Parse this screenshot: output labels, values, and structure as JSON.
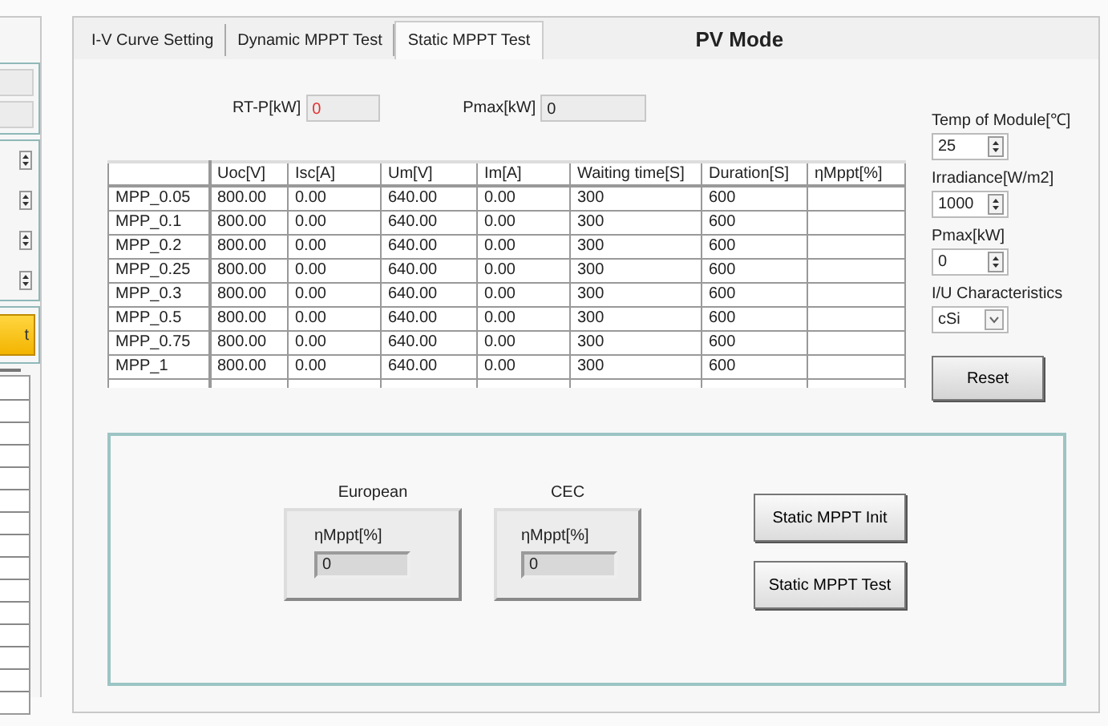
{
  "left_panel": {
    "button": "t"
  },
  "tabs": [
    {
      "label": "I-V Curve Setting",
      "selected": false
    },
    {
      "label": "Dynamic MPPT Test",
      "selected": false
    },
    {
      "label": "Static MPPT Test",
      "selected": true
    }
  ],
  "mode_title": "PV Mode",
  "readouts": [
    {
      "label": "RT-P[kW]",
      "value": "0",
      "color": "#e03030"
    },
    {
      "label": "Pmax[kW]",
      "value": "0",
      "color": "#222222"
    }
  ],
  "table": {
    "columns": [
      "Uoc[V]",
      "Isc[A]",
      "Um[V]",
      "Im[A]",
      "Waiting time[S]",
      "Duration[S]",
      "ηMppt[%]"
    ],
    "rows": [
      {
        "name": "MPP_0.05",
        "cells": [
          "800.00",
          "0.00",
          "640.00",
          "0.00",
          "300",
          "600"
        ]
      },
      {
        "name": "MPP_0.1",
        "cells": [
          "800.00",
          "0.00",
          "640.00",
          "0.00",
          "300",
          "600"
        ]
      },
      {
        "name": "MPP_0.2",
        "cells": [
          "800.00",
          "0.00",
          "640.00",
          "0.00",
          "300",
          "600"
        ]
      },
      {
        "name": "MPP_0.25",
        "cells": [
          "800.00",
          "0.00",
          "640.00",
          "0.00",
          "300",
          "600"
        ]
      },
      {
        "name": "MPP_0.3",
        "cells": [
          "800.00",
          "0.00",
          "640.00",
          "0.00",
          "300",
          "600"
        ]
      },
      {
        "name": "MPP_0.5",
        "cells": [
          "800.00",
          "0.00",
          "640.00",
          "0.00",
          "300",
          "600"
        ]
      },
      {
        "name": "MPP_0.75",
        "cells": [
          "800.00",
          "0.00",
          "640.00",
          "0.00",
          "300",
          "600"
        ]
      },
      {
        "name": "MPP_1",
        "cells": [
          "800.00",
          "0.00",
          "640.00",
          "0.00",
          "300",
          "600"
        ]
      }
    ]
  },
  "settings": [
    {
      "label": "Temp of Module[℃]",
      "value": "25",
      "kind": "spinner"
    },
    {
      "label": "Irradiance[W/m2]",
      "value": "1000",
      "kind": "spinner"
    },
    {
      "label": "Pmax[kW]",
      "value": "0",
      "kind": "spinner"
    },
    {
      "label": "I/U Characteristics",
      "value": "cSi",
      "kind": "dropdown"
    }
  ],
  "reset_button": "Reset",
  "efficiency": {
    "groups": [
      {
        "title": "European",
        "label": "ηMppt[%]",
        "value": "0"
      },
      {
        "title": "CEC",
        "label": "ηMppt[%]",
        "value": "0"
      }
    ],
    "buttons": [
      "Static MPPT Init",
      "Static MPPT Test"
    ]
  }
}
